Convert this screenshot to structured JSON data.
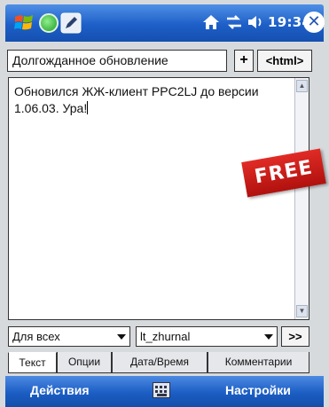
{
  "statusbar": {
    "time": "19:34"
  },
  "compose": {
    "subject_value": "Долгожданное обновление",
    "plus_label": "+",
    "html_label": "<html>",
    "message_text": "Обновился ЖЖ-клиент PPC2LJ до версии 1.06.03. Ура!"
  },
  "badge": {
    "label": "FREE"
  },
  "selectors": {
    "audience_selected": "Для всех",
    "journal_selected": "lt_zhurnal",
    "next_label": ">>"
  },
  "tabs": [
    {
      "label": "Текст",
      "active": true
    },
    {
      "label": "Опции"
    },
    {
      "label": "Дата/Время"
    },
    {
      "label": "Комментарии"
    }
  ],
  "softkeys": {
    "left": "Действия",
    "right": "Настройки"
  },
  "colors": {
    "bar_blue": "#1d5fc7",
    "badge_red": "#d0211c"
  }
}
